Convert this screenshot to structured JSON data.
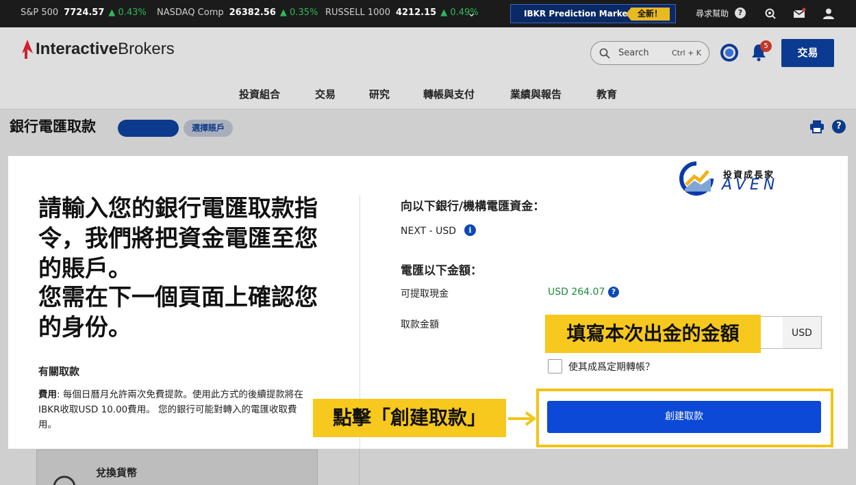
{
  "ticker": {
    "items": [
      {
        "name": "S&P 500",
        "value": "7724.57",
        "change": "▲ 0.43%"
      },
      {
        "name": "NASDAQ Comp",
        "value": "26382.56",
        "change": "▲ 0.35%"
      },
      {
        "name": "RUSSELL 1000",
        "value": "4212.15",
        "change": "▲ 0.49%"
      }
    ],
    "promo_label": "IBKR Prediction Markets",
    "promo_badge": "全新！",
    "help_label": "尋求幫助",
    "help_q": "?"
  },
  "header": {
    "logo_bold": "Interactive",
    "logo_rest": "Brokers",
    "search_placeholder": "Search",
    "search_shortcut": "Ctrl + K",
    "notifications": "5",
    "trade_button": "交易",
    "nav": [
      "投資組合",
      "交易",
      "研究",
      "轉帳與支付",
      "業績與報告",
      "教育"
    ]
  },
  "page": {
    "title": "銀行電匯取款",
    "select_account": "選擇賬戶",
    "help": "?"
  },
  "left": {
    "heading": "請輸入您的銀行電匯取款指令，我們將把資金電匯至您的賬戶。",
    "heading2": "您需在下一個頁面上確認您的身份。",
    "sub_heading": "有關取款",
    "fee_label": "費用",
    "fee_text": ": 每個日曆月允許兩次免費提款。使用此方式的後續提款將在IBKR收取USD 10.00費用。 您的銀行可能對轉入的電匯收取費用。",
    "exchange_label": "兌換貨幣"
  },
  "right": {
    "heading1": "向以下銀行/機構電匯資金：",
    "bank": "NEXT - USD",
    "info": "i",
    "heading2": "電匯以下金額：",
    "available_label": "可提取現金",
    "available_value": "USD 264.07",
    "q": "?",
    "amount_label": "取款金額",
    "currency": "USD",
    "recurring_label": "使其成爲定期轉帳？",
    "create_button": "創建取款"
  },
  "annotations": {
    "callout_amount": "填寫本次出金的金額",
    "callout_click": "點擊「創建取款」",
    "highlight_color": "#f2c414"
  },
  "watermark": {
    "line1": "投資成長家",
    "line2": "AVEN"
  },
  "colors": {
    "ib_blue": "#0b3a91",
    "button_blue": "#0c49d6",
    "positive_green": "#1c8a3a",
    "callout_yellow": "#f7c81d"
  }
}
